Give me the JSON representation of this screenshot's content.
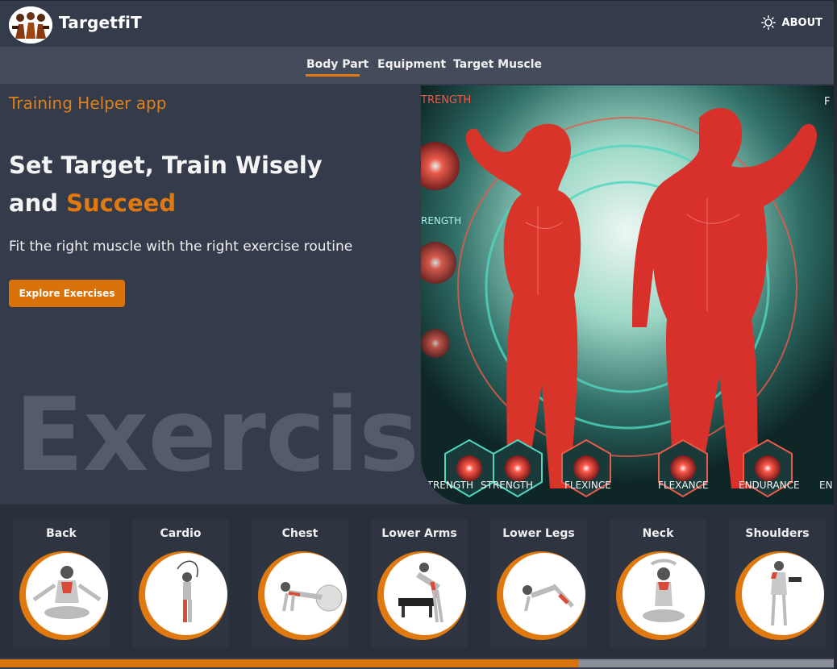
{
  "header": {
    "brand": "TargetfiT",
    "about_label": "ABOUT",
    "logo_icon": "team-logo-icon",
    "theme_icon": "sun-icon"
  },
  "nav": {
    "tabs": [
      {
        "label": "Body Part",
        "active": true
      },
      {
        "label": "Equipment",
        "active": false
      },
      {
        "label": "Target Muscle",
        "active": false
      }
    ]
  },
  "hero": {
    "tagline": "Training Helper app",
    "headline_line1": "Set Target, Train Wisely",
    "headline_and": "and ",
    "headline_accent": "Succeed",
    "subline": "Fit the right muscle with the right exercise routine",
    "cta_label": "Explore Exercises",
    "background_word": "Exercise",
    "image_labels": [
      "STRENGTH",
      "STRENGTH",
      "FLEXINCE",
      "FLEXANCE",
      "ENDURANCE",
      "EN",
      "TRENGTH",
      "RENGTH",
      "F"
    ]
  },
  "categories": [
    {
      "label": "Back",
      "icon": "back-exercise-icon"
    },
    {
      "label": "Cardio",
      "icon": "cardio-exercise-icon"
    },
    {
      "label": "Chest",
      "icon": "chest-exercise-icon"
    },
    {
      "label": "Lower Arms",
      "icon": "lower-arms-exercise-icon"
    },
    {
      "label": "Lower Legs",
      "icon": "lower-legs-exercise-icon"
    },
    {
      "label": "Neck",
      "icon": "neck-exercise-icon"
    },
    {
      "label": "Shoulders",
      "icon": "shoulders-exercise-icon"
    }
  ],
  "scrollbar": {
    "position_fraction": 0.0,
    "visible_fraction": 0.69
  },
  "colors": {
    "accent": "#e07a10",
    "background": "#343b4a",
    "nav_background": "#444b5a",
    "strip_background": "#2a303b"
  }
}
